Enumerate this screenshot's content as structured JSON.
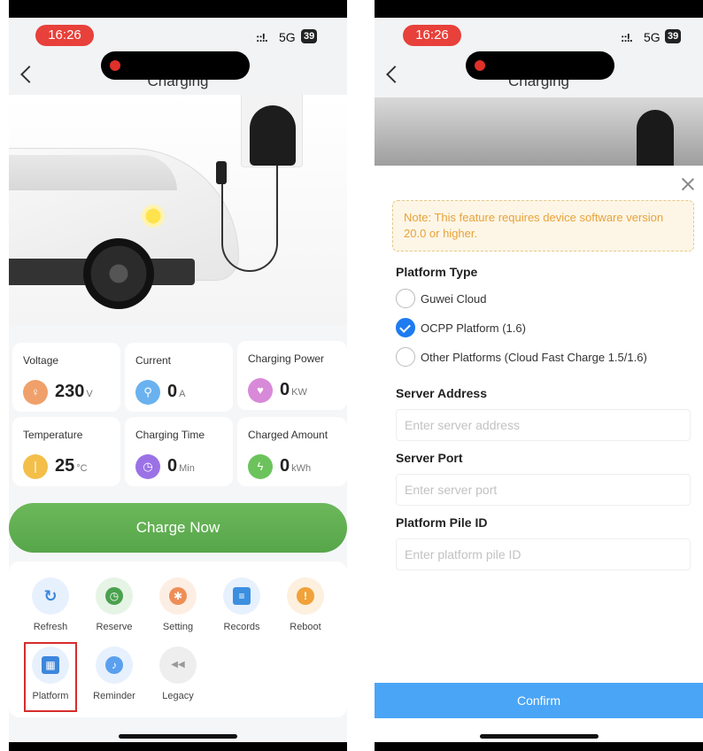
{
  "status_bar": {
    "time": "16:26",
    "signal": "::!.",
    "network": "5G",
    "battery": "39"
  },
  "left": {
    "nav_title": "Charging",
    "metrics": [
      {
        "label": "Voltage",
        "value": "230",
        "unit": "V"
      },
      {
        "label": "Current",
        "value": "0",
        "unit": "A"
      },
      {
        "label": "Charging Power",
        "value": "0",
        "unit": "KW"
      },
      {
        "label": "Temperature",
        "value": "25",
        "unit": "°C"
      },
      {
        "label": "Charging Time",
        "value": "0",
        "unit": "Min"
      },
      {
        "label": "Charged Amount",
        "value": "0",
        "unit": "kWh"
      }
    ],
    "charge_button": "Charge Now",
    "tools": [
      {
        "label": "Refresh",
        "glyph": "↻"
      },
      {
        "label": "Reserve",
        "glyph": "◷"
      },
      {
        "label": "Setting",
        "glyph": "✱"
      },
      {
        "label": "Records",
        "glyph": "≡"
      },
      {
        "label": "Reboot",
        "glyph": "!"
      },
      {
        "label": "Platform",
        "glyph": "▦"
      },
      {
        "label": "Reminder",
        "glyph": "♪"
      },
      {
        "label": "Legacy",
        "glyph": "◀◀"
      }
    ]
  },
  "right": {
    "nav_title": "Charging",
    "note": "Note: This feature requires device software version 20.0 or higher.",
    "platform_type_title": "Platform Type",
    "platform_options": [
      {
        "label": "Guwei Cloud",
        "selected": false
      },
      {
        "label": "OCPP Platform (1.6)",
        "selected": true
      },
      {
        "label": "Other Platforms (Cloud Fast Charge 1.5/1.6)",
        "selected": false
      }
    ],
    "server_address": {
      "title": "Server Address",
      "placeholder": "Enter server address"
    },
    "server_port": {
      "title": "Server Port",
      "placeholder": "Enter server port"
    },
    "pile_id": {
      "title": "Platform Pile ID",
      "placeholder": "Enter platform pile ID"
    },
    "confirm_button": "Confirm"
  },
  "colors": {
    "accent_green": "#5aa84c",
    "accent_blue": "#1e7bf0",
    "confirm_blue": "#4aa5f6",
    "note_text": "#e8a23a",
    "highlight_red": "#d62c2c",
    "time_pill": "#e8403a"
  }
}
